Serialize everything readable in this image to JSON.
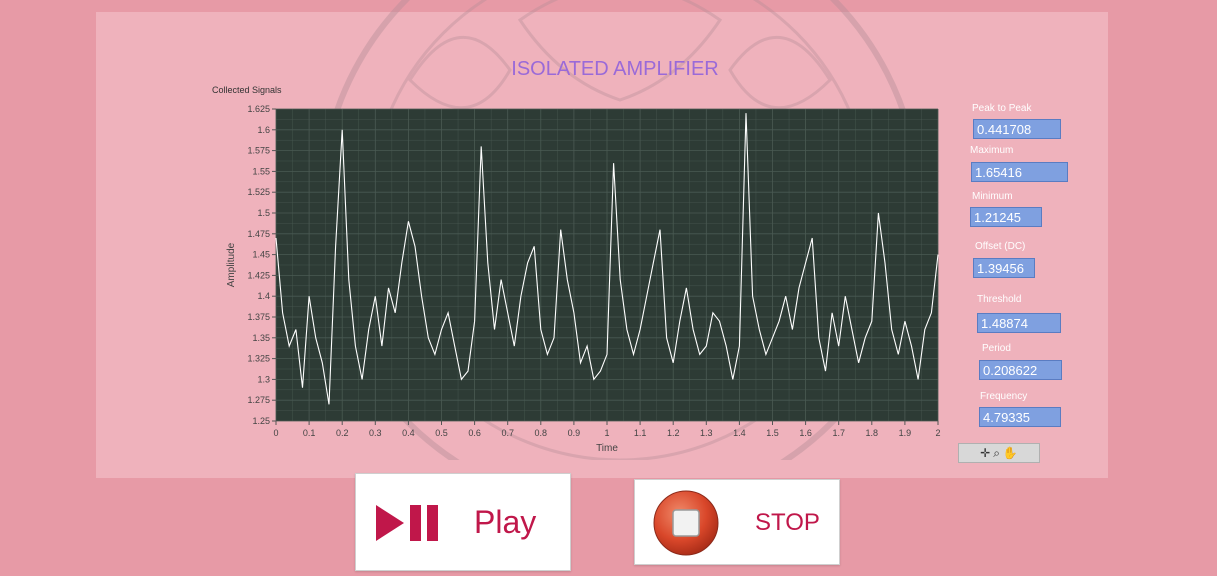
{
  "app": {
    "title": "ISOLATED AMPLIFIER"
  },
  "graph": {
    "title": "Collected Signals"
  },
  "chart_data": {
    "type": "line",
    "title": "Collected Signals",
    "xlabel": "Time",
    "ylabel": "Amplitude",
    "xlim": [
      0,
      2
    ],
    "ylim": [
      1.25,
      1.625
    ],
    "x_ticks": [
      "0",
      "0.1",
      "0.2",
      "0.3",
      "0.4",
      "0.5",
      "0.6",
      "0.7",
      "0.8",
      "0.9",
      "1",
      "1.1",
      "1.2",
      "1.3",
      "1.4",
      "1.5",
      "1.6",
      "1.7",
      "1.8",
      "1.9",
      "2"
    ],
    "y_ticks": [
      "1.25",
      "1.275",
      "1.3",
      "1.325",
      "1.35",
      "1.375",
      "1.4",
      "1.425",
      "1.45",
      "1.475",
      "1.5",
      "1.525",
      "1.55",
      "1.575",
      "1.6",
      "1.625"
    ],
    "grid": true,
    "background": "#2d3b35",
    "line_color": "#ffffff",
    "series": [
      {
        "x": [
          0,
          0.02,
          0.04,
          0.06,
          0.08,
          0.1,
          0.12,
          0.14,
          0.16,
          0.18,
          0.2,
          0.22,
          0.24,
          0.26,
          0.28,
          0.3,
          0.32,
          0.34,
          0.36,
          0.38,
          0.4,
          0.42,
          0.44,
          0.46,
          0.48,
          0.5,
          0.52,
          0.54,
          0.56,
          0.58,
          0.6,
          0.62,
          0.64,
          0.66,
          0.68,
          0.7,
          0.72,
          0.74,
          0.76,
          0.78,
          0.8,
          0.82,
          0.84,
          0.86,
          0.88,
          0.9,
          0.92,
          0.94,
          0.96,
          0.98,
          1.0,
          1.02,
          1.04,
          1.06,
          1.08,
          1.1,
          1.12,
          1.14,
          1.16,
          1.18,
          1.2,
          1.22,
          1.24,
          1.26,
          1.28,
          1.3,
          1.32,
          1.34,
          1.36,
          1.38,
          1.4,
          1.42,
          1.44,
          1.46,
          1.48,
          1.5,
          1.52,
          1.54,
          1.56,
          1.58,
          1.6,
          1.62,
          1.64,
          1.66,
          1.68,
          1.7,
          1.72,
          1.74,
          1.76,
          1.78,
          1.8,
          1.82,
          1.84,
          1.86,
          1.88,
          1.9,
          1.92,
          1.94,
          1.96,
          1.98,
          2.0
        ],
        "y": [
          1.47,
          1.38,
          1.34,
          1.36,
          1.29,
          1.4,
          1.35,
          1.32,
          1.27,
          1.46,
          1.6,
          1.42,
          1.34,
          1.3,
          1.36,
          1.4,
          1.34,
          1.41,
          1.38,
          1.44,
          1.49,
          1.46,
          1.4,
          1.35,
          1.33,
          1.36,
          1.38,
          1.34,
          1.3,
          1.31,
          1.37,
          1.58,
          1.44,
          1.36,
          1.42,
          1.38,
          1.34,
          1.4,
          1.44,
          1.46,
          1.36,
          1.33,
          1.35,
          1.48,
          1.42,
          1.38,
          1.32,
          1.34,
          1.3,
          1.31,
          1.33,
          1.56,
          1.42,
          1.36,
          1.33,
          1.36,
          1.4,
          1.44,
          1.48,
          1.35,
          1.32,
          1.37,
          1.41,
          1.36,
          1.33,
          1.34,
          1.38,
          1.37,
          1.34,
          1.3,
          1.34,
          1.62,
          1.4,
          1.36,
          1.33,
          1.35,
          1.37,
          1.4,
          1.36,
          1.41,
          1.44,
          1.47,
          1.35,
          1.31,
          1.38,
          1.34,
          1.4,
          1.36,
          1.32,
          1.35,
          1.37,
          1.5,
          1.44,
          1.36,
          1.33,
          1.37,
          1.34,
          1.3,
          1.36,
          1.38,
          1.45
        ]
      }
    ]
  },
  "indicators": [
    {
      "label": "Peak to Peak",
      "value": "0.441708"
    },
    {
      "label": "Maximum",
      "value": "1.65416"
    },
    {
      "label": "Minimum",
      "value": "1.21245"
    },
    {
      "label": "Offset (DC)",
      "value": "1.39456"
    },
    {
      "label": "Threshold",
      "value": "1.48874"
    },
    {
      "label": "Period",
      "value": "0.208622"
    },
    {
      "label": "Frequency",
      "value": "4.79335"
    }
  ],
  "graph_tools": {
    "icons": [
      "crosshair-icon",
      "zoom-icon",
      "pan-icon"
    ]
  },
  "buttons": {
    "play_label": "Play",
    "stop_label": "STOP"
  },
  "colors": {
    "background": "#e79aa6",
    "panel": "#efb2bc",
    "indicator": "#7fa0e0",
    "button_text": "#c0174a",
    "title": "#9a6ad8"
  }
}
